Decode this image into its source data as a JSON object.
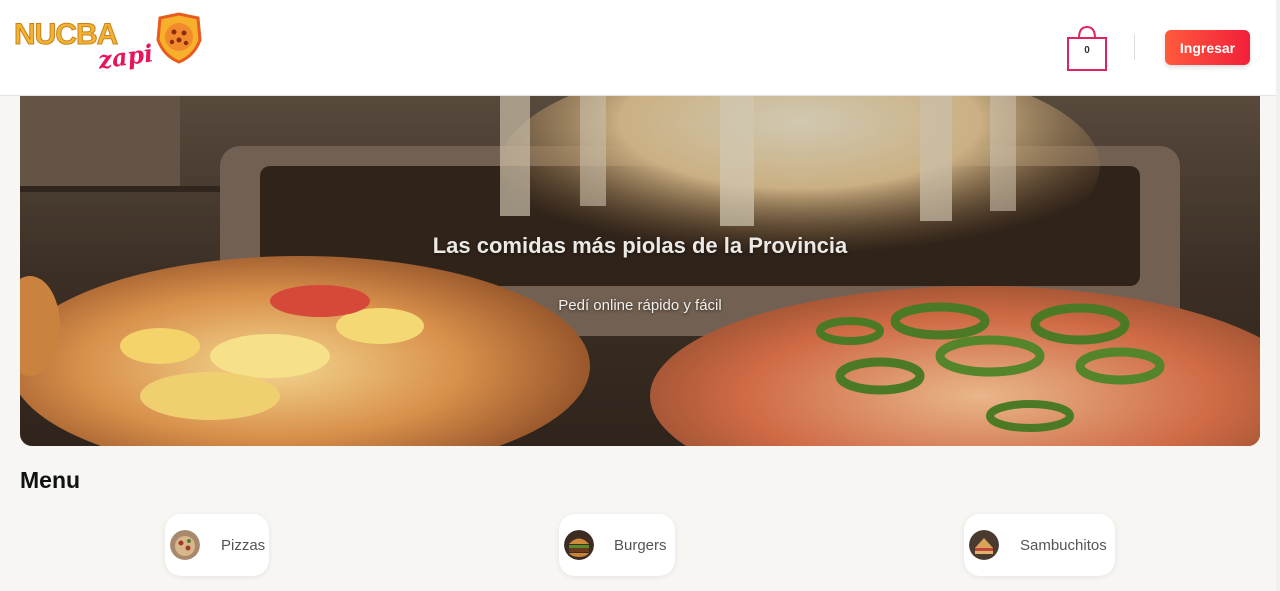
{
  "header": {
    "logo_word": "NUCBA",
    "logo_script": "zapi",
    "cart_count": "0",
    "login_label": "Ingresar",
    "accent_color": "#f2263d"
  },
  "hero": {
    "title": "Las comidas más piolas de la Provincia",
    "subtitle": "Pedí online rápido y fácil"
  },
  "menu": {
    "title": "Menu",
    "categories": [
      {
        "label": "Pizzas",
        "icon": "pizza-thumb"
      },
      {
        "label": "Burgers",
        "icon": "burger-thumb"
      },
      {
        "label": "Sambuchitos",
        "icon": "sandwich-thumb"
      }
    ]
  }
}
